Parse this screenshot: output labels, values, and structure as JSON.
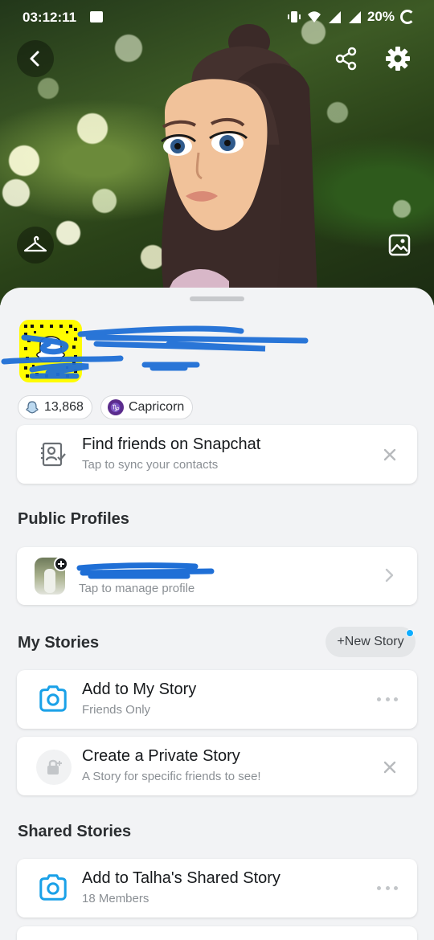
{
  "status_bar": {
    "time": "03:12:11",
    "battery": "20%"
  },
  "profile": {
    "score": "13,868",
    "zodiac_symbol": "♑",
    "zodiac": "Capricorn"
  },
  "find_friends": {
    "title": "Find friends on Snapchat",
    "subtitle": "Tap to sync your contacts"
  },
  "public_profiles": {
    "heading": "Public Profiles",
    "subtitle": "Tap to manage profile"
  },
  "my_stories": {
    "heading": "My Stories",
    "new_story_label": "+New Story",
    "items": [
      {
        "title": "Add to My Story",
        "subtitle": "Friends Only"
      },
      {
        "title": "Create a Private Story",
        "subtitle": "A Story for specific friends to see!"
      }
    ]
  },
  "shared_stories": {
    "heading": "Shared Stories",
    "items": [
      {
        "title": "Add to Talha's Shared Story",
        "subtitle": "18 Members"
      }
    ]
  },
  "colors": {
    "accent_blue": "#0eadff",
    "snap_yellow": "#fffc00",
    "scribble_blue": "#1f6fd6"
  }
}
